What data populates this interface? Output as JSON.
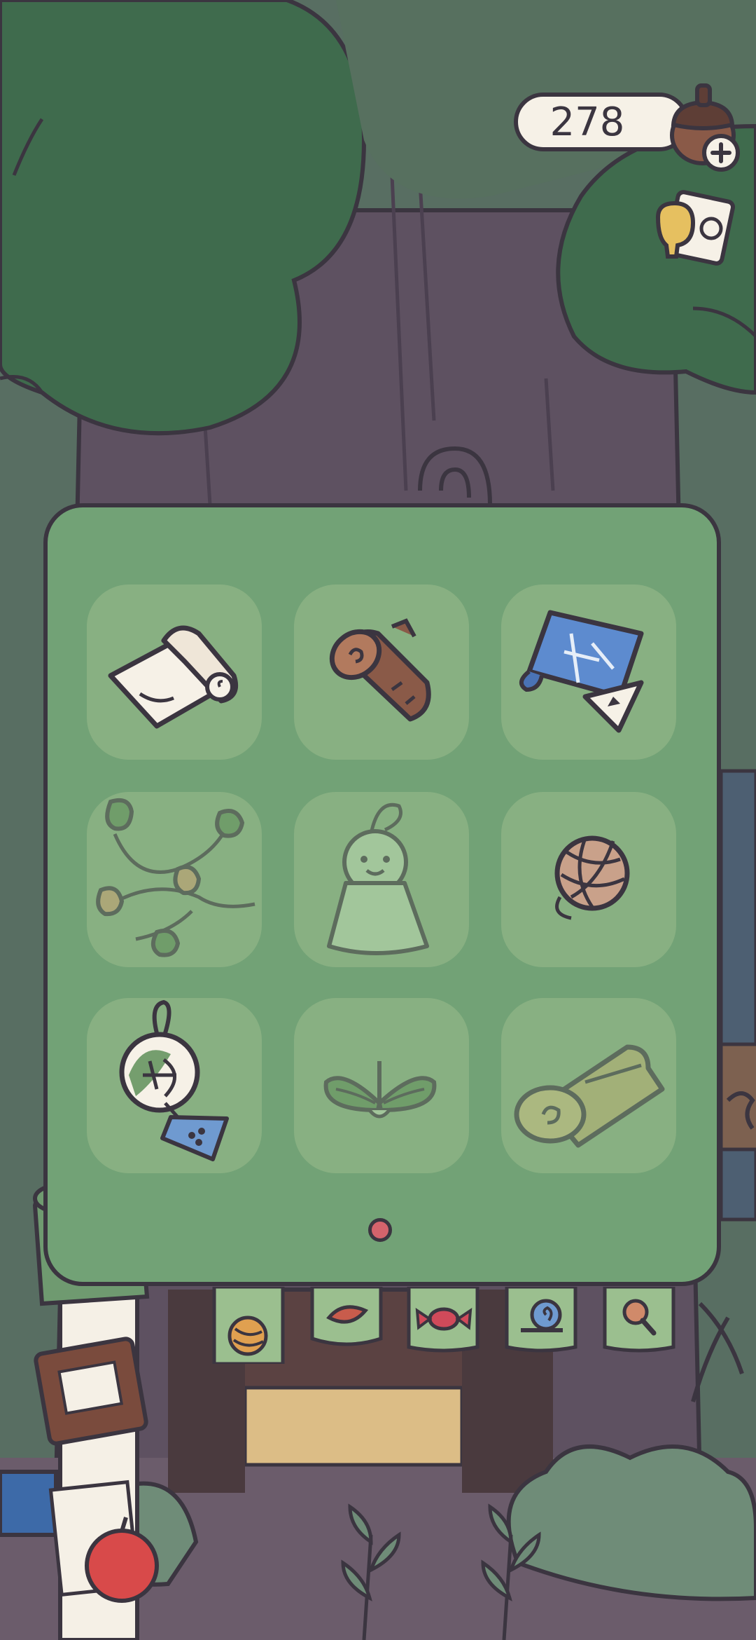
{
  "hud": {
    "acorn_count": "278",
    "currency_icon": "acorn-icon",
    "add_icon": "plus-icon",
    "notes_icon": "notes-icon"
  },
  "inventory": {
    "page_indicator": {
      "pages": 1,
      "current": 1
    },
    "items": [
      {
        "name": "paper-roll",
        "icon": "paper-roll-icon",
        "available": true
      },
      {
        "name": "log",
        "icon": "log-icon",
        "available": true
      },
      {
        "name": "blueprint",
        "icon": "blueprint-icon",
        "available": true
      },
      {
        "name": "mitten-garland",
        "icon": "mitten-garland-icon",
        "available": false
      },
      {
        "name": "teru-teru-bozu",
        "icon": "teru-teru-bozu-icon",
        "available": false
      },
      {
        "name": "yarn-ball",
        "icon": "yarn-ball-icon",
        "available": true
      },
      {
        "name": "wind-chime",
        "icon": "wind-chime-icon",
        "available": true
      },
      {
        "name": "leaf-sprout",
        "icon": "leaf-sprout-icon",
        "available": false
      },
      {
        "name": "rolled-mat",
        "icon": "rolled-mat-icon",
        "available": false
      }
    ]
  },
  "shop_flags": [
    {
      "icon": "yarn-ball-icon"
    },
    {
      "icon": "leaf-icon"
    },
    {
      "icon": "candy-icon"
    },
    {
      "icon": "snail-icon"
    },
    {
      "icon": "magnifier-icon"
    }
  ],
  "colors": {
    "panel": "#72a276",
    "outline": "#3b3540",
    "page_dot": "#d4636c"
  }
}
